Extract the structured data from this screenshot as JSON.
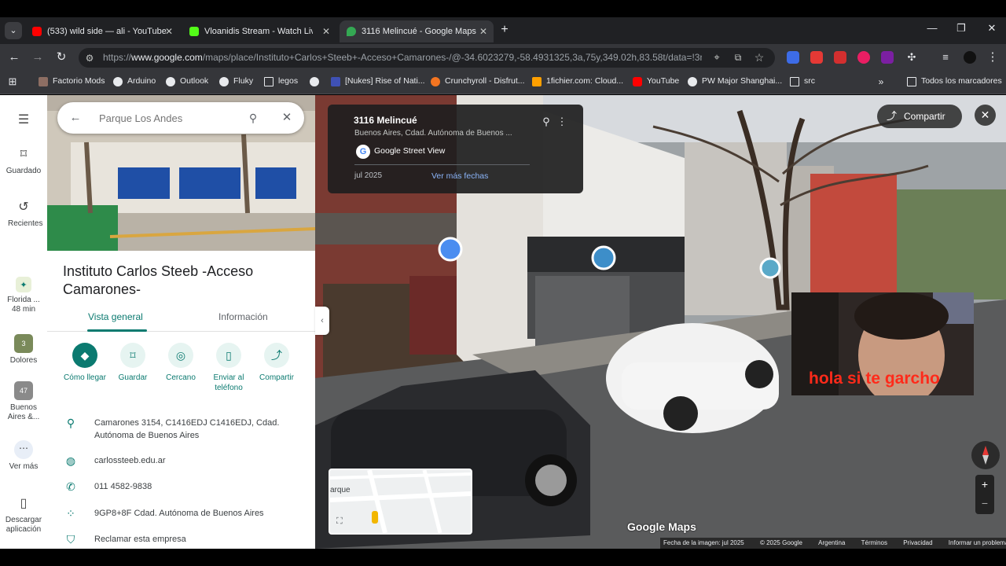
{
  "browser": {
    "tabs": [
      {
        "title": "(533) wild side — ali - YouTube",
        "favicon_color": "#ff0000"
      },
      {
        "title": "Vloanidis Stream - Watch Live on Kick",
        "favicon_color": "#53fc18"
      },
      {
        "title": "3116 Melincué - Google Maps",
        "favicon_color": "#34a853"
      }
    ],
    "url_prefix": "https://",
    "url_host": "www.google.com",
    "url_rest": "/maps/place/Instituto+Carlos+Steeb+-Acceso+Camarones-/@-34.6023279,-58.4931325,3a,75y,349.02h,83.58t/data=!3m7...",
    "bookmarks": [
      "Factorio Mods",
      "Arduino",
      "Outlook",
      "Fluky",
      "legos",
      "",
      "[Nukes] Rise of Nati...",
      "Crunchyroll - Disfrut...",
      "1fichier.com: Cloud...",
      "YouTube",
      "PW Major Shanghai...",
      "src"
    ],
    "all_bookmarks": "Todos los marcadores"
  },
  "rail": {
    "saved": "Guardado",
    "recent": "Recientes",
    "trip": "Florida ...\n48 min",
    "dolores": "Dolores",
    "dolores_badge": "3",
    "ba_badge": "47",
    "ba": "Buenos Aires &...",
    "more": "Ver más",
    "download": "Descargar aplicación"
  },
  "panel": {
    "search_placeholder": "Parque Los Andes",
    "title": "Instituto Carlos Steeb -Acceso Camarones-",
    "tab_overview": "Vista general",
    "tab_info": "Información",
    "actions": [
      "Cómo llegar",
      "Guardar",
      "Cercano",
      "Enviar al teléfono",
      "Compartir"
    ],
    "address": "Camarones 3154, C1416EDJ C1416EDJ, Cdad. Autónoma de Buenos Aires",
    "website": "carlossteeb.edu.ar",
    "phone": "011 4582-9838",
    "plus_code": "9GP8+8F Cdad. Autónoma de Buenos Aires",
    "claim": "Reclamar esta empresa"
  },
  "streetview": {
    "title": "3116 Melincué",
    "subtitle": "Buenos Aires, Cdad. Autónoma de Buenos ...",
    "brand": "Google Street View",
    "date": "jul 2025",
    "more_dates": "Ver más fechas",
    "share": "Compartir",
    "minimap_label": "arque",
    "caption": "hola si te garcho",
    "watermark": "Google Maps",
    "footer": [
      "Fecha de la imagen: jul 2025",
      "© 2025 Google",
      "Argentina",
      "Términos",
      "Privacidad",
      "Informar un problema"
    ]
  }
}
